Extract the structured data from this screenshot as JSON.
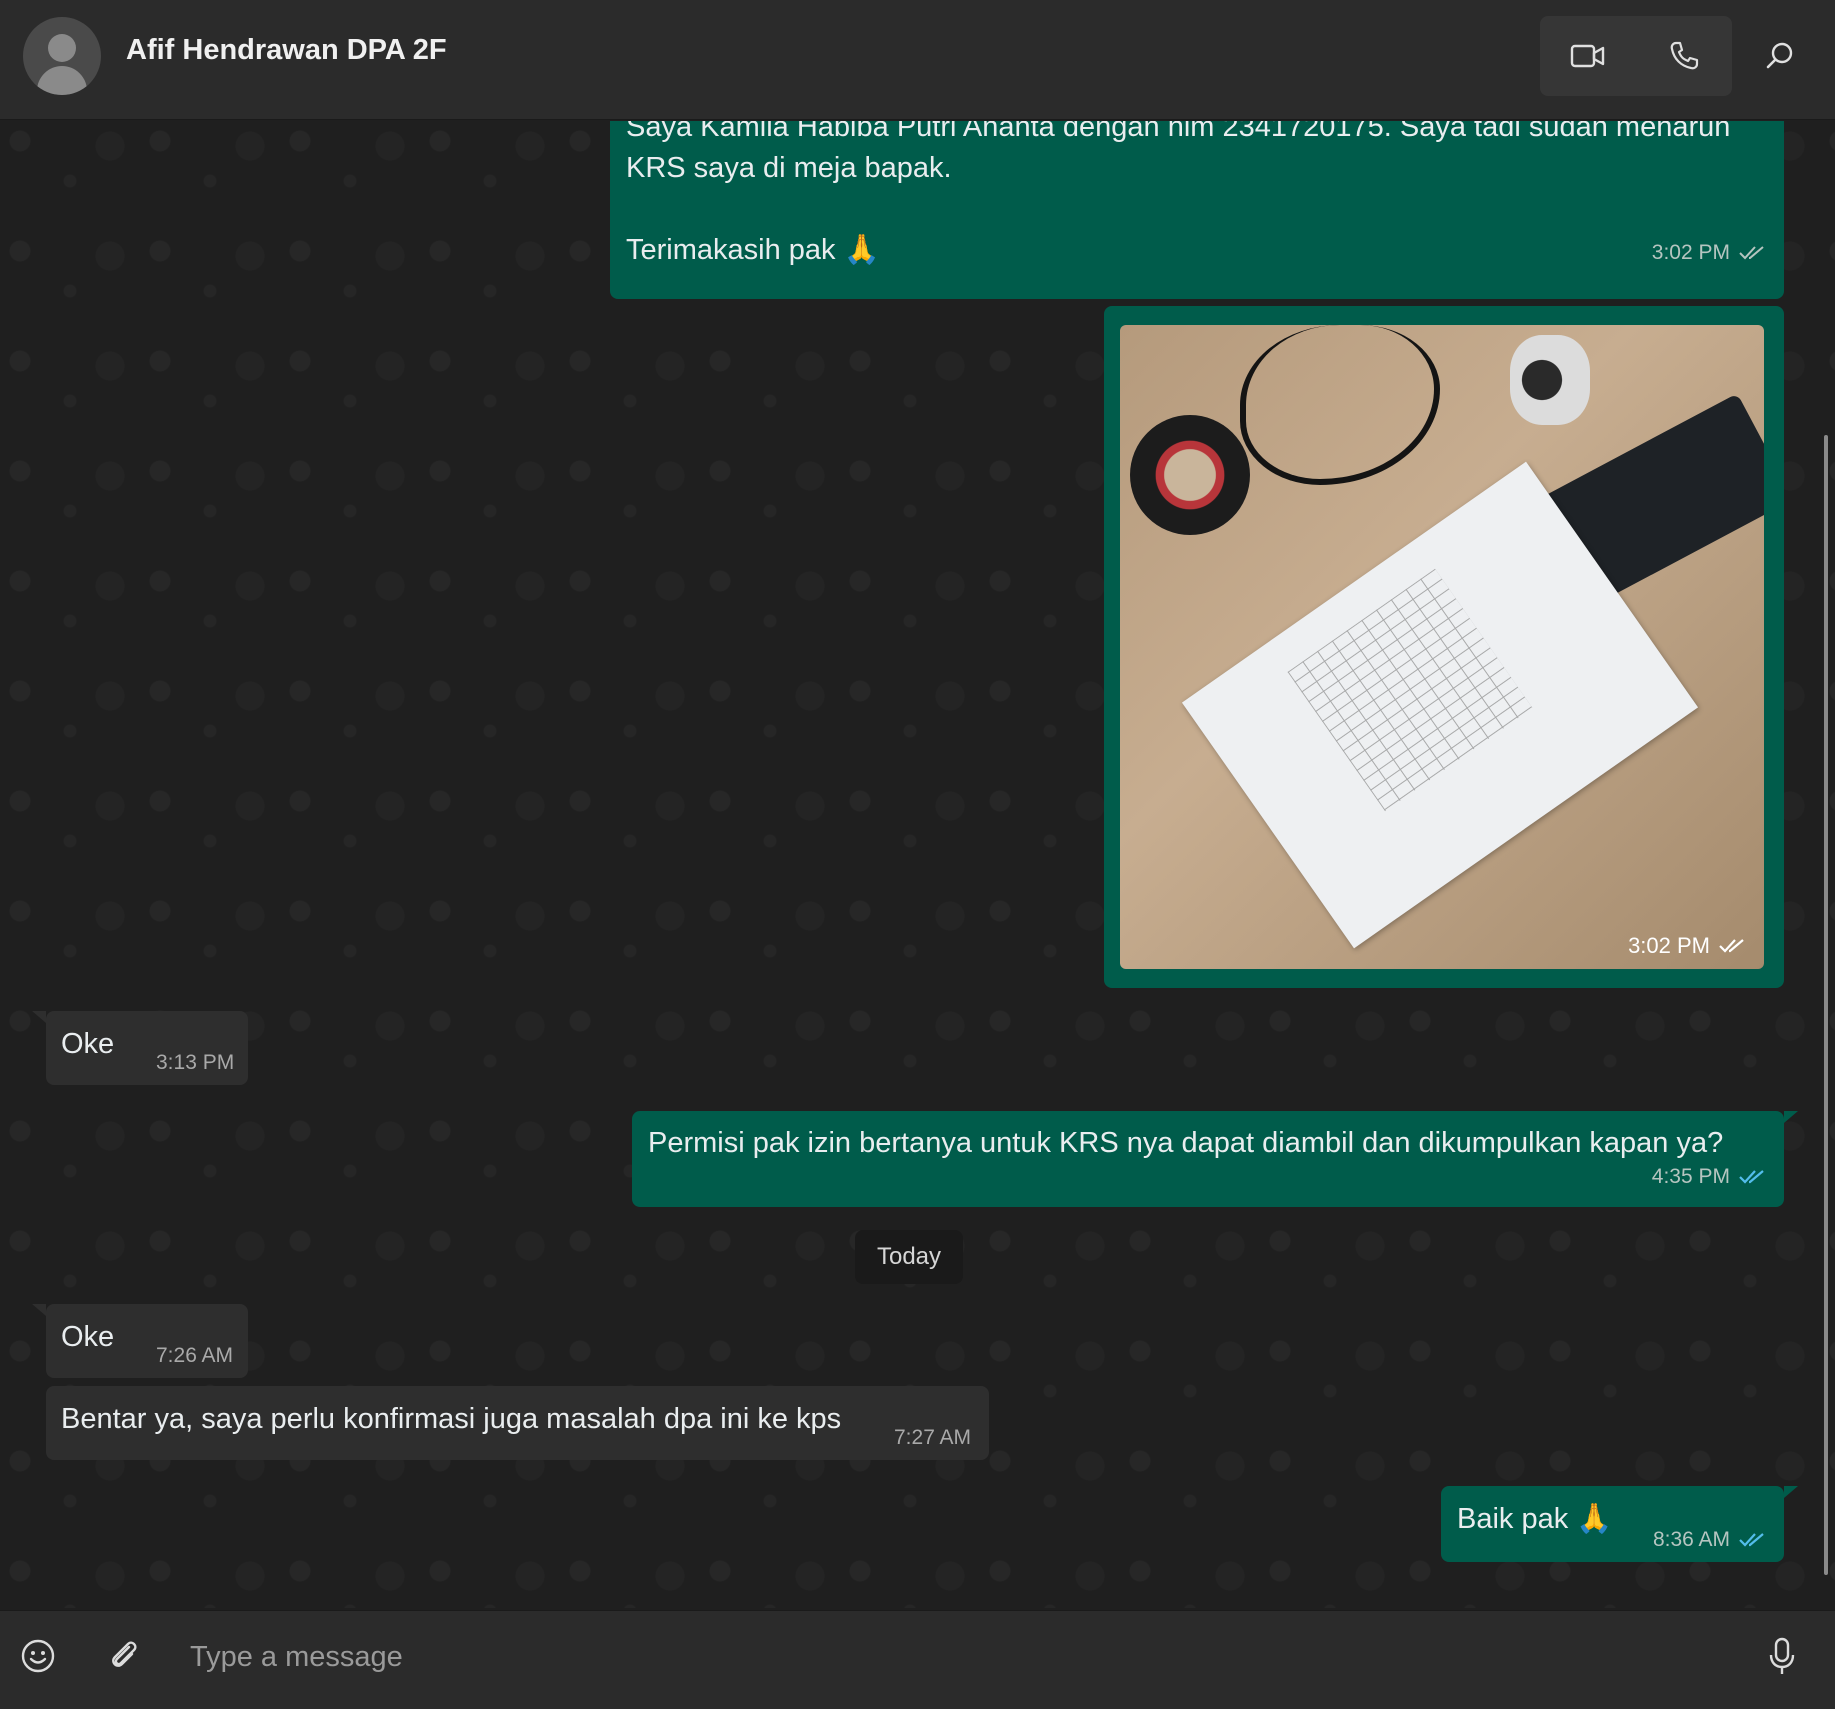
{
  "header": {
    "contact_name": "Afif Hendrawan DPA 2F",
    "icons": {
      "avatar": "user-avatar-icon",
      "video": "video-call-icon",
      "voice": "voice-call-icon",
      "search": "search-icon"
    }
  },
  "messages": [
    {
      "direction": "out",
      "text": "Saya Kamila Habiba Putri Ananta dengan nim 2341720175. Saya tadi sudah menaruh\nKRS saya di meja bapak.\n\nTerimakasih pak 🙏",
      "time": "3:02 PM",
      "status": "read"
    },
    {
      "direction": "out",
      "type": "image",
      "image_description": "Photo of a KRS (Kartu Rencana Studi) document on a wooden desk",
      "time": "3:02 PM",
      "status": "read"
    },
    {
      "direction": "in",
      "text": "Oke",
      "time": "3:13 PM"
    },
    {
      "direction": "out",
      "text": "Permisi pak izin bertanya untuk KRS nya dapat diambil dan dikumpulkan kapan ya?",
      "time": "4:35 PM",
      "status": "read"
    },
    {
      "direction": "in",
      "text": "Oke",
      "time": "7:26 AM"
    },
    {
      "direction": "in",
      "text": "Bentar ya, saya perlu konfirmasi juga masalah dpa ini ke kps",
      "time": "7:27 AM"
    },
    {
      "direction": "out",
      "text": "Baik pak 🙏",
      "time": "8:36 AM",
      "status": "read"
    }
  ],
  "date_divider": "Today",
  "composer": {
    "placeholder": "Type a message",
    "icons": {
      "emoji": "emoji-icon",
      "attach": "paperclip-icon",
      "mic": "microphone-icon"
    }
  },
  "colors": {
    "outgoing_bubble": "#005c4b",
    "incoming_bubble": "#2e2e2e",
    "read_tick": "#53bdeb",
    "background": "#1f1f1f"
  }
}
